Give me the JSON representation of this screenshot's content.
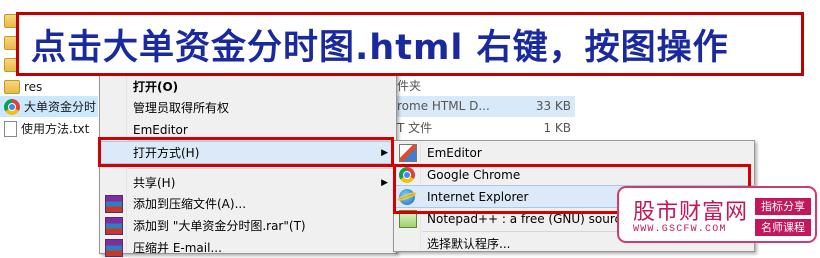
{
  "banner": {
    "text": "点击大单资金分时图.html  右键，按图操作"
  },
  "files": [
    {
      "name": "",
      "icon": "folder-icon"
    },
    {
      "name": "",
      "icon": "folder-icon"
    },
    {
      "name": "",
      "icon": "folder-icon"
    },
    {
      "name": "res",
      "icon": "folder-icon"
    },
    {
      "name": "大单资金分时",
      "icon": "chrome-icon"
    },
    {
      "name": "使用方法.txt",
      "icon": "text-file-icon"
    }
  ],
  "file_meta": {
    "row_res_type": "件夹",
    "row_html_type": "rome HTML D...",
    "row_html_size": "33 KB",
    "row_txt_type": "T 文件",
    "row_txt_size": "1 KB"
  },
  "context_menu": {
    "items": [
      {
        "label": "打开(O)"
      },
      {
        "label": "管理员取得所有权"
      },
      {
        "label": "EmEditor"
      },
      {
        "label": "打开方式(H)"
      },
      {
        "label": "共享(H)"
      },
      {
        "label": "添加到压缩文件(A)..."
      },
      {
        "label": "添加到 \"大单资金分时图.rar\"(T)"
      },
      {
        "label": "压缩并 E-mail..."
      }
    ]
  },
  "open_with_menu": {
    "items": [
      {
        "label": "EmEditor"
      },
      {
        "label": "Google Chrome"
      },
      {
        "label": "Internet Explorer"
      },
      {
        "label": "Notepad++ : a free (GNU) source"
      },
      {
        "label": "选择默认程序..."
      }
    ]
  },
  "watermark": {
    "title": "股市财富网",
    "url": "WWW.GSCFW.COM",
    "tag1": "指标分享",
    "tag2": "名师课程"
  },
  "colors": {
    "annotation": "#d40000",
    "banner_text": "#1a2a9c",
    "watermark": "#c2185b"
  }
}
